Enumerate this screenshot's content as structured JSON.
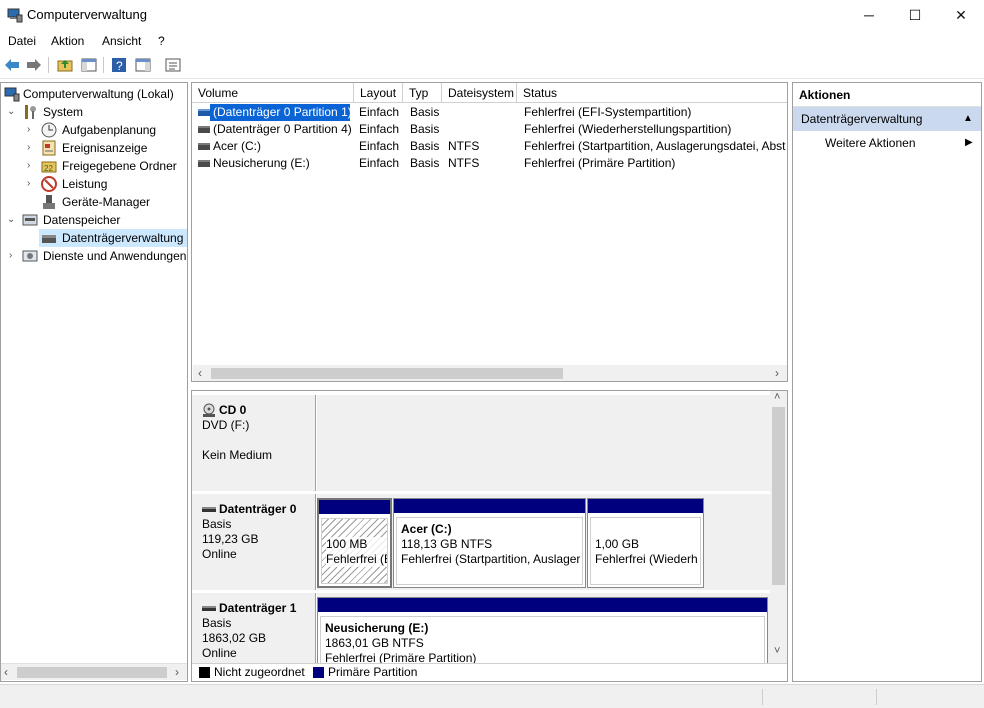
{
  "window": {
    "title": "Computerverwaltung",
    "minimize": "─",
    "maximize": "☐",
    "close": "✕"
  },
  "menu": [
    "Datei",
    "Aktion",
    "Ansicht",
    "?"
  ],
  "toolbar": [
    "back-icon",
    "forward-icon",
    "up-folder-icon",
    "show-hide-tree-icon",
    "help-icon",
    "show-hide-action-pane-icon",
    "properties-icon"
  ],
  "tree": {
    "root": "Computerverwaltung (Lokal)",
    "items": [
      {
        "label": "System",
        "icon": "tools-icon"
      },
      {
        "label": "Aufgabenplanung",
        "icon": "clock-icon"
      },
      {
        "label": "Ereignisanzeige",
        "icon": "event-viewer-icon"
      },
      {
        "label": "Freigegebene Ordner",
        "icon": "shared-folder-icon"
      },
      {
        "label": "Leistung",
        "icon": "performance-icon"
      },
      {
        "label": "Geräte-Manager",
        "icon": "device-manager-icon"
      },
      {
        "label": "Datenspeicher",
        "icon": "storage-icon"
      },
      {
        "label": "Datenträgerverwaltung",
        "icon": "disk-management-icon"
      },
      {
        "label": "Dienste und Anwendungen",
        "icon": "services-icon"
      }
    ]
  },
  "volumes": {
    "columns": [
      "Volume",
      "Layout",
      "Typ",
      "Dateisystem",
      "Status"
    ],
    "rows": [
      [
        "(Datenträger 0 Partition 1)",
        "Einfach",
        "Basis",
        "",
        "Fehlerfrei (EFI-Systempartition)"
      ],
      [
        "(Datenträger 0 Partition 4)",
        "Einfach",
        "Basis",
        "",
        "Fehlerfrei (Wiederherstellungspartition)"
      ],
      [
        "Acer (C:)",
        "Einfach",
        "Basis",
        "NTFS",
        "Fehlerfrei (Startpartition, Auslagerungsdatei, Abstu"
      ],
      [
        "Neusicherung (E:)",
        "Einfach",
        "Basis",
        "NTFS",
        "Fehlerfrei (Primäre Partition)"
      ]
    ]
  },
  "disks": {
    "cd0": {
      "name": "CD 0",
      "line1": "DVD (F:)",
      "line2": "Kein Medium"
    },
    "disk0": {
      "name": "Datenträger 0",
      "type": "Basis",
      "size": "119,23 GB",
      "state": "Online",
      "partitions": [
        {
          "title": "",
          "size": "100 MB",
          "status": "Fehlerfrei (E"
        },
        {
          "title": "Acer  (C:)",
          "size": "118,13 GB NTFS",
          "status": "Fehlerfrei (Startpartition, Auslager"
        },
        {
          "title": "",
          "size": "1,00 GB",
          "status": "Fehlerfrei (Wiederh"
        }
      ]
    },
    "disk1": {
      "name": "Datenträger 1",
      "type": "Basis",
      "size": "1863,02 GB",
      "state": "Online",
      "partitions": [
        {
          "title": "Neusicherung  (E:)",
          "size": "1863,01 GB NTFS",
          "status": "Fehlerfrei (Primäre Partition)"
        }
      ]
    }
  },
  "legend": {
    "unallocated": "Nicht zugeordnet",
    "primary": "Primäre Partition",
    "unallocated_color": "#000000",
    "primary_color": "#00007f"
  },
  "actions": {
    "title": "Aktionen",
    "section": "Datenträgerverwaltung",
    "more": "Weitere Aktionen"
  }
}
